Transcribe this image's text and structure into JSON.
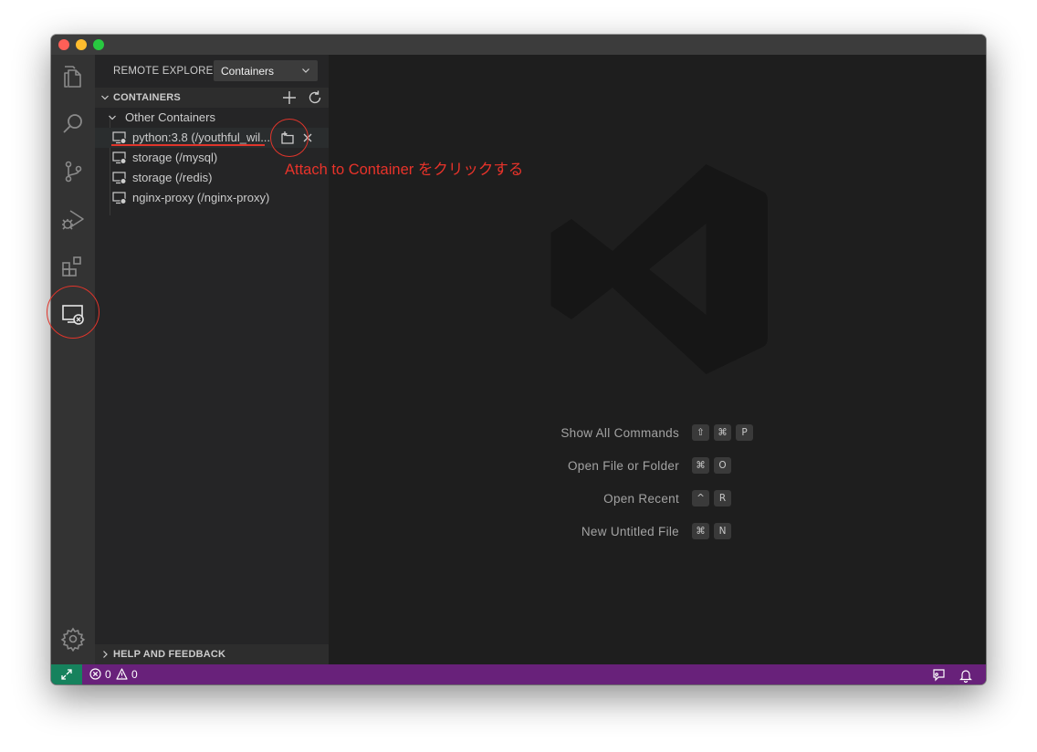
{
  "window": {
    "traffic_lights": [
      "close",
      "minimize",
      "maximize"
    ]
  },
  "activity_bar": {
    "items": [
      {
        "name": "explorer",
        "icon": "files-icon"
      },
      {
        "name": "search",
        "icon": "search-icon"
      },
      {
        "name": "source-control",
        "icon": "source-control-icon"
      },
      {
        "name": "run-debug",
        "icon": "run-debug-icon"
      },
      {
        "name": "extensions",
        "icon": "extensions-icon"
      },
      {
        "name": "remote-explorer",
        "icon": "remote-explorer-icon",
        "active": true
      }
    ],
    "bottom_icon": "gear-icon"
  },
  "sidebar": {
    "title": "REMOTE EXPLORER",
    "target_select": {
      "value": "Containers"
    },
    "containers_section": {
      "title": "CONTAINERS",
      "actions": [
        "add-icon",
        "refresh-icon"
      ],
      "group": {
        "label": "Other Containers",
        "items": [
          {
            "label": "python:3.8 (/youthful_wil...",
            "selected": true,
            "actions": [
              "attach-container-icon",
              "close-icon"
            ]
          },
          {
            "label": "storage (/mysql)"
          },
          {
            "label": "storage (/redis)"
          },
          {
            "label": "nginx-proxy (/nginx-proxy)"
          }
        ]
      }
    },
    "help_section": {
      "title": "HELP AND FEEDBACK"
    }
  },
  "editor": {
    "watermark_icon": "vscode-logo-icon",
    "shortcuts": [
      {
        "label": "Show All Commands",
        "keys": [
          "⇧",
          "⌘",
          "P"
        ]
      },
      {
        "label": "Open File or Folder",
        "keys": [
          "⌘",
          "O"
        ]
      },
      {
        "label": "Open Recent",
        "keys": [
          "^",
          "R"
        ]
      },
      {
        "label": "New Untitled File",
        "keys": [
          "⌘",
          "N"
        ]
      }
    ]
  },
  "status_bar": {
    "errors": "0",
    "warnings": "0",
    "right_icons": [
      "feedback-icon",
      "bell-icon"
    ]
  },
  "annotation": {
    "text": "Attach to Container をクリックする",
    "color": "#e0352b"
  },
  "colors": {
    "status_bar": "#68217a",
    "remote_indicator": "#16825d",
    "editor_bg": "#1e1e1e",
    "sidebar_bg": "#252526",
    "activity_bar_bg": "#333333"
  }
}
